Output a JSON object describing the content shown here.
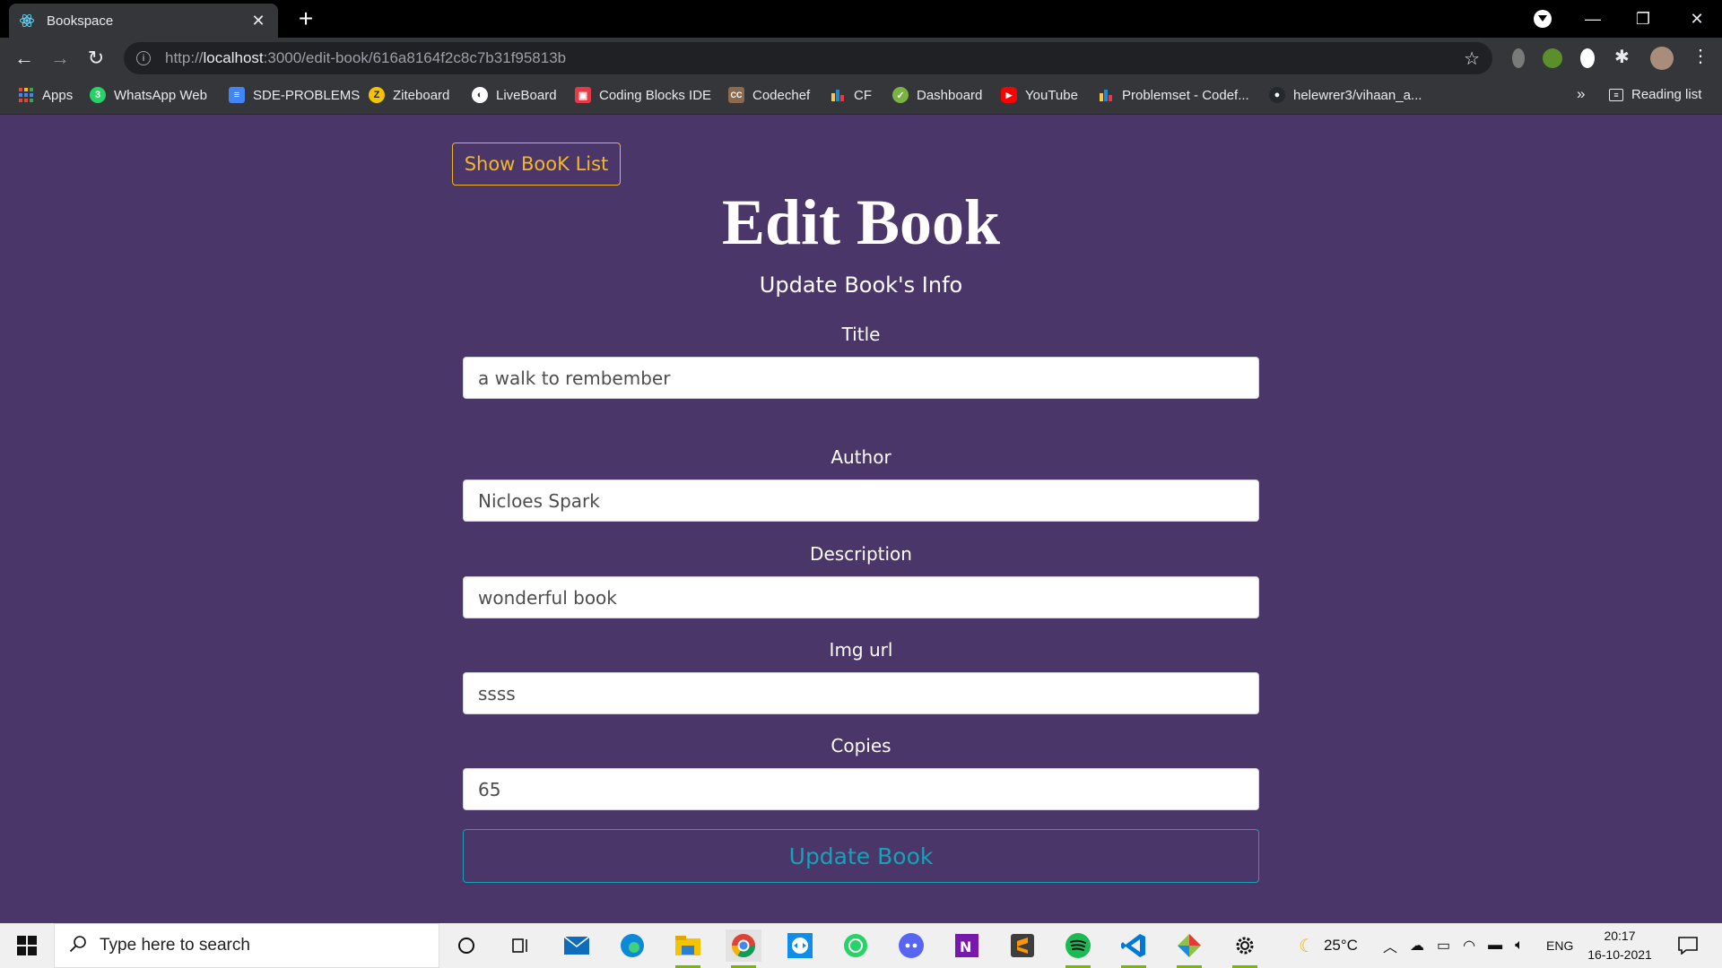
{
  "browser": {
    "tab_title": "Bookspace",
    "url_scheme": "http://",
    "url_host": "localhost",
    "url_rest": ":3000/edit-book/616a8164f2c8c7b31f95813b"
  },
  "bookmarks": [
    {
      "label": "Apps",
      "icon": "apps-grid-icon",
      "color": "#4285f4"
    },
    {
      "label": "WhatsApp Web",
      "icon": "whatsapp-icon",
      "color": "#25d366"
    },
    {
      "label": "SDE-PROBLEMS",
      "icon": "docs-icon",
      "color": "#4285f4"
    },
    {
      "label": "Ziteboard",
      "icon": "ziteboard-icon",
      "color": "#f5c400"
    },
    {
      "label": "LiveBoard",
      "icon": "liveboard-icon",
      "color": "#ffffff"
    },
    {
      "label": "Coding Blocks IDE",
      "icon": "coding-blocks-icon",
      "color": "#e63946"
    },
    {
      "label": "Codechef",
      "icon": "codechef-icon",
      "color": "#8b6a4f"
    },
    {
      "label": "CF",
      "icon": "codeforces-icon",
      "color": "#1f8acb"
    },
    {
      "label": "Dashboard",
      "icon": "dashboard-icon",
      "color": "#7bb342"
    },
    {
      "label": "YouTube",
      "icon": "youtube-icon",
      "color": "#ff0000"
    },
    {
      "label": "Problemset - Codef...",
      "icon": "codeforces-icon",
      "color": "#1f8acb"
    },
    {
      "label": "helewrer3/vihaan_a...",
      "icon": "github-icon",
      "color": "#24292e"
    }
  ],
  "bookmarks_overflow": "»",
  "reading_list": "Reading list",
  "page": {
    "show_list_button": "Show BooK List",
    "title": "Edit Book",
    "subtitle": "Update Book's Info",
    "fields": {
      "title": {
        "label": "Title",
        "value": "a walk to rembember"
      },
      "author": {
        "label": "Author",
        "value": "Nicloes Spark"
      },
      "description": {
        "label": "Description",
        "value": "wonderful book"
      },
      "img_url": {
        "label": "Img url",
        "value": "ssss"
      },
      "copies": {
        "label": "Copies",
        "value": "65"
      }
    },
    "submit_button": "Update Book"
  },
  "taskbar": {
    "search_placeholder": "Type here to search",
    "weather": "25°C",
    "language": "ENG",
    "time": "20:17",
    "date": "16-10-2021"
  },
  "colors": {
    "page_bg": "#4a3669",
    "show_list_accent": "#f5b726",
    "update_accent": "#17a2b8"
  }
}
